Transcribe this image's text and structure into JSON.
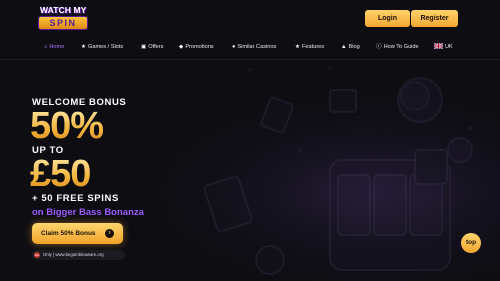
{
  "brand": {
    "line1": "WATCH MY",
    "line2": "SPIN"
  },
  "header": {
    "login_label": "Login",
    "register_label": "Register"
  },
  "nav": {
    "items": [
      {
        "label": "Home",
        "icon": "home-icon"
      },
      {
        "label": "Games / Slots",
        "icon": "star-icon"
      },
      {
        "label": "Offers",
        "icon": "offers-icon"
      },
      {
        "label": "Promotions",
        "icon": "gift-icon"
      },
      {
        "label": "Similar Casinos",
        "icon": "globe-icon"
      },
      {
        "label": "Features",
        "icon": "star-icon"
      },
      {
        "label": "Blog",
        "icon": "blog-icon"
      },
      {
        "label": "How To Guide",
        "icon": "info-icon"
      },
      {
        "label": "UK",
        "icon": "uk-flag-icon"
      }
    ]
  },
  "hero": {
    "line1": "WELCOME BONUS",
    "percent": "50%",
    "line2": "UP TO",
    "amount": "£50",
    "line3": "+ 50 FREE SPINS",
    "game": "on Bigger Bass Bonanza",
    "cta_label": "Claim 50% Bonus",
    "disclaimer_age": "18+",
    "disclaimer_text": "Only | www.begambleaware.org"
  },
  "badge": {
    "label": "top"
  },
  "colors": {
    "background": "#0d0d12",
    "accent": "#f2a731",
    "purple": "#9b5cff"
  }
}
